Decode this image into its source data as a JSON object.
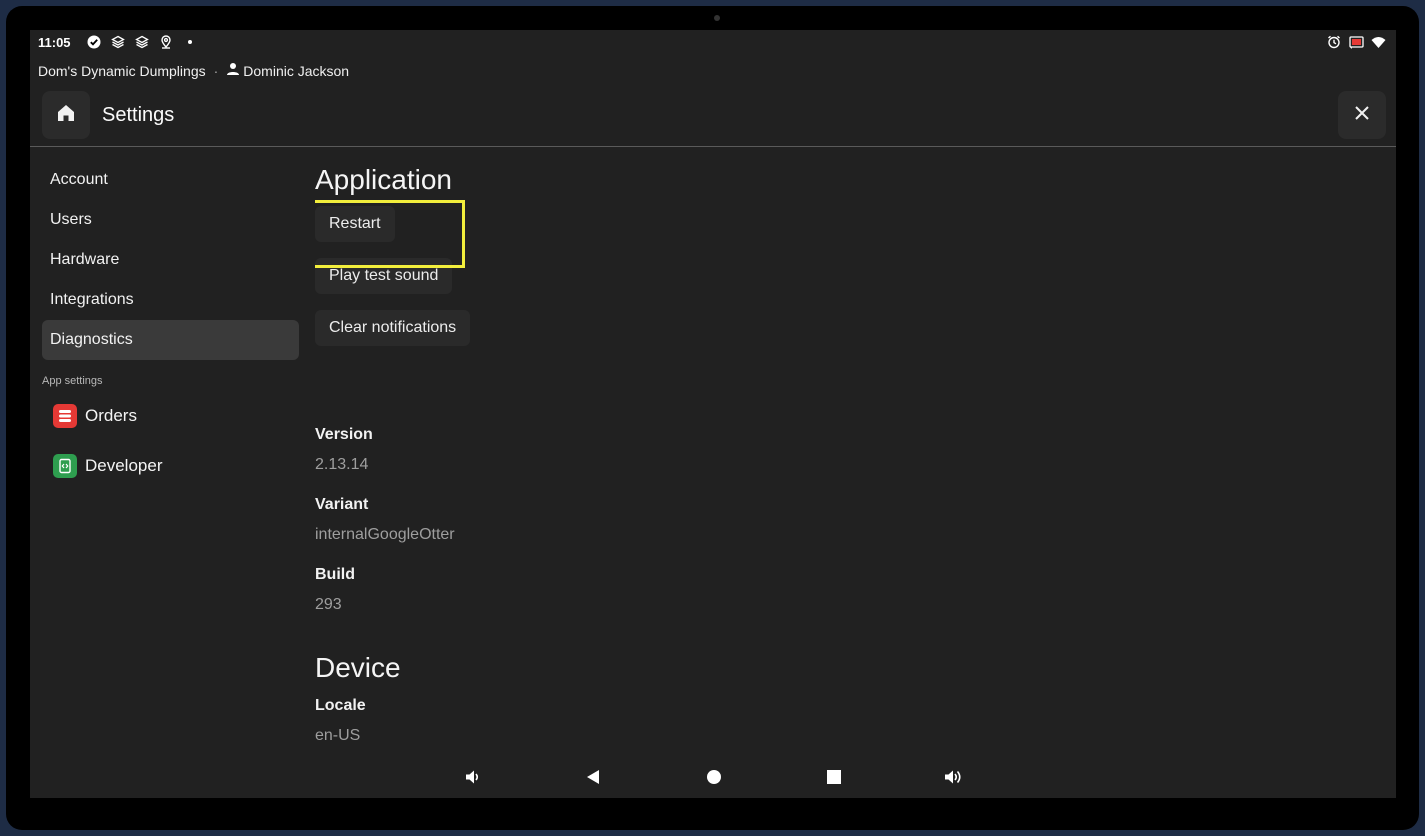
{
  "status_bar": {
    "time": "11:05",
    "left_icons": [
      "check-circle-icon",
      "stack-icon",
      "stack-icon",
      "location-icon"
    ],
    "right_icons": [
      "alarm-icon",
      "cast-icon",
      "wifi-icon"
    ]
  },
  "header_info": {
    "store_name": "Dom's Dynamic Dumplings",
    "separator": "·",
    "user_name": "Dominic Jackson"
  },
  "header": {
    "title": "Settings"
  },
  "sidebar": {
    "items": [
      {
        "label": "Account",
        "active": false
      },
      {
        "label": "Users",
        "active": false
      },
      {
        "label": "Hardware",
        "active": false
      },
      {
        "label": "Integrations",
        "active": false
      },
      {
        "label": "Diagnostics",
        "active": true
      }
    ],
    "section_label": "App settings",
    "apps": [
      {
        "label": "Orders",
        "icon": "orders-icon",
        "color": "#e53935"
      },
      {
        "label": "Developer",
        "icon": "developer-icon",
        "color": "#2e9e4f"
      }
    ]
  },
  "main": {
    "application_title": "Application",
    "buttons": {
      "restart": "Restart",
      "play_test_sound": "Play test sound",
      "clear_notifications": "Clear notifications"
    },
    "info": [
      {
        "label": "Version",
        "value": "2.13.14"
      },
      {
        "label": "Variant",
        "value": "internalGoogleOtter"
      },
      {
        "label": "Build",
        "value": "293"
      }
    ],
    "device_title": "Device",
    "device_info": [
      {
        "label": "Locale",
        "value": "en-US"
      }
    ]
  },
  "highlight_color": "#f2ee3c",
  "navbar": {
    "icons": [
      "volume-down-icon",
      "back-icon",
      "home-circle-icon",
      "recents-icon",
      "volume-up-icon"
    ]
  }
}
